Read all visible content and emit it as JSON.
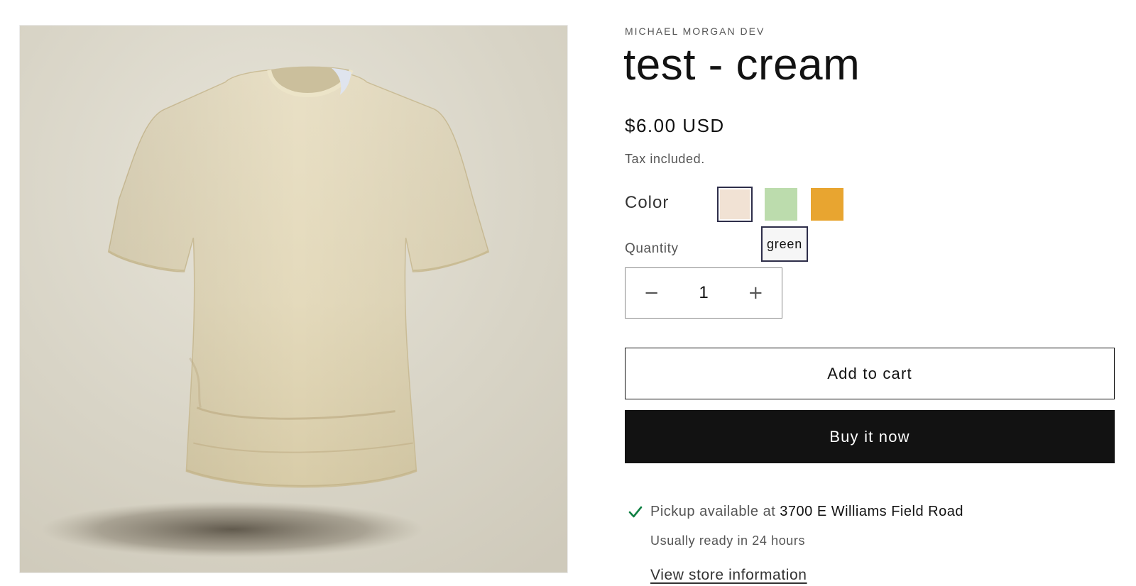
{
  "product": {
    "vendor": "MICHAEL MORGAN DEV",
    "title": "test - cream",
    "price": "$6.00 USD",
    "tax_note": "Tax included.",
    "image_alt": "cream t-shirt"
  },
  "color_picker": {
    "label": "Color",
    "swatches": [
      {
        "name": "cream",
        "color": "#f1e2d4",
        "selected": true
      },
      {
        "name": "green",
        "color": "#bcdcad",
        "selected": false
      },
      {
        "name": "orange",
        "color": "#e8a530",
        "selected": false
      }
    ],
    "tooltip": "green"
  },
  "quantity": {
    "label": "Quantity",
    "value": "1",
    "decrease_icon": "minus-icon",
    "increase_icon": "plus-icon"
  },
  "actions": {
    "add_to_cart": "Add to cart",
    "buy_now": "Buy it now"
  },
  "pickup": {
    "status_icon": "check-icon",
    "status_color": "#108043",
    "text": "Pickup available at",
    "location": "3700 E Williams Field Road",
    "ready_time": "Usually ready in 24 hours",
    "store_link": "View store information"
  },
  "colors": {
    "image_background": "#d9d5c8",
    "shirt": "#e6dcc0"
  }
}
